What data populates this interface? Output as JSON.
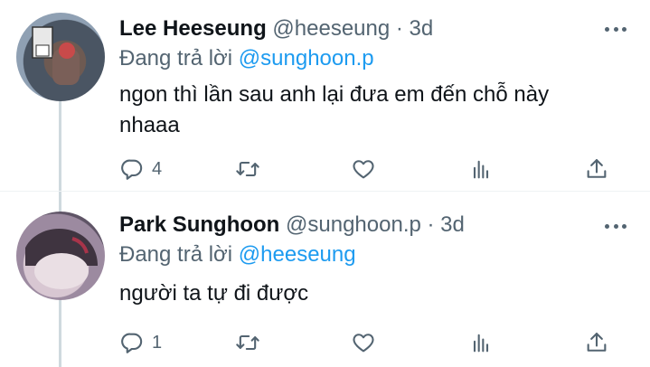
{
  "tweets": [
    {
      "name": "Lee Heeseung",
      "handle": "@heeseung",
      "dot": "·",
      "time": "3d",
      "replying_prefix": "Đang trả lời",
      "replying_to": "@sunghoon.p",
      "text": "ngon thì lần sau anh lại đưa em đến chỗ này nhaaa",
      "reply_count": "4",
      "icons": [
        "reply-icon",
        "retweet-icon",
        "like-icon",
        "analytics-icon",
        "share-icon",
        "more-icon"
      ]
    },
    {
      "name": "Park Sunghoon",
      "handle": "@sunghoon.p",
      "dot": "·",
      "time": "3d",
      "replying_prefix": "Đang trả lời",
      "replying_to": "@heeseung",
      "text": "người ta tự đi được",
      "reply_count": "1",
      "icons": [
        "reply-icon",
        "retweet-icon",
        "like-icon",
        "analytics-icon",
        "share-icon",
        "more-icon"
      ]
    }
  ],
  "colors": {
    "text": "#0f1419",
    "secondary": "#536471",
    "accent": "#1d9bf0",
    "thread_line": "#cfd9de"
  }
}
